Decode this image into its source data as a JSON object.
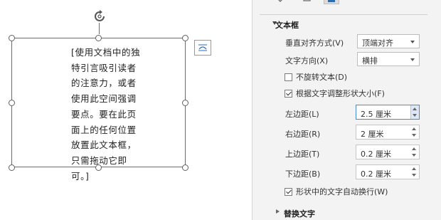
{
  "textbox": {
    "text": "[使用文档中的独特引言吸引读者的注意力，或者使用此空间强调要点。要在此页面上的任何位置放置此文本框，只需拖动它即可。]"
  },
  "icons": {
    "rotate": "rotate-icon",
    "layout_options": "layout-options-icon",
    "tab_fill": "fill-line-icon",
    "tab_effects": "effects-icon",
    "tab_layout": "layout-properties-icon"
  },
  "pane": {
    "section_textbox": "文本框",
    "vertical_align": {
      "label": "垂直对齐方式(V)",
      "value": "顶端对齐"
    },
    "text_direction": {
      "label": "文字方向(X)",
      "value": "横排"
    },
    "no_rotate": {
      "label": "不旋转文本(D)",
      "checked": false
    },
    "autofit": {
      "label": "根据文字调整形状大小(F)",
      "checked": true
    },
    "margin_left": {
      "label": "左边距(L)",
      "value": "2.5 厘米"
    },
    "margin_right": {
      "label": "右边距(R)",
      "value": "2 厘米"
    },
    "margin_top": {
      "label": "上边距(T)",
      "value": "0.2 厘米"
    },
    "margin_bottom": {
      "label": "下边距(B)",
      "value": "0.2 厘米"
    },
    "wrap_text": {
      "label": "形状中的文字自动换行(W)",
      "checked": true
    },
    "section_alt_text": "替换文字"
  },
  "colors": {
    "pane_bg": "#f3f3f3",
    "accent_blue": "#4a8ad4",
    "border": "#6b6b6b"
  }
}
